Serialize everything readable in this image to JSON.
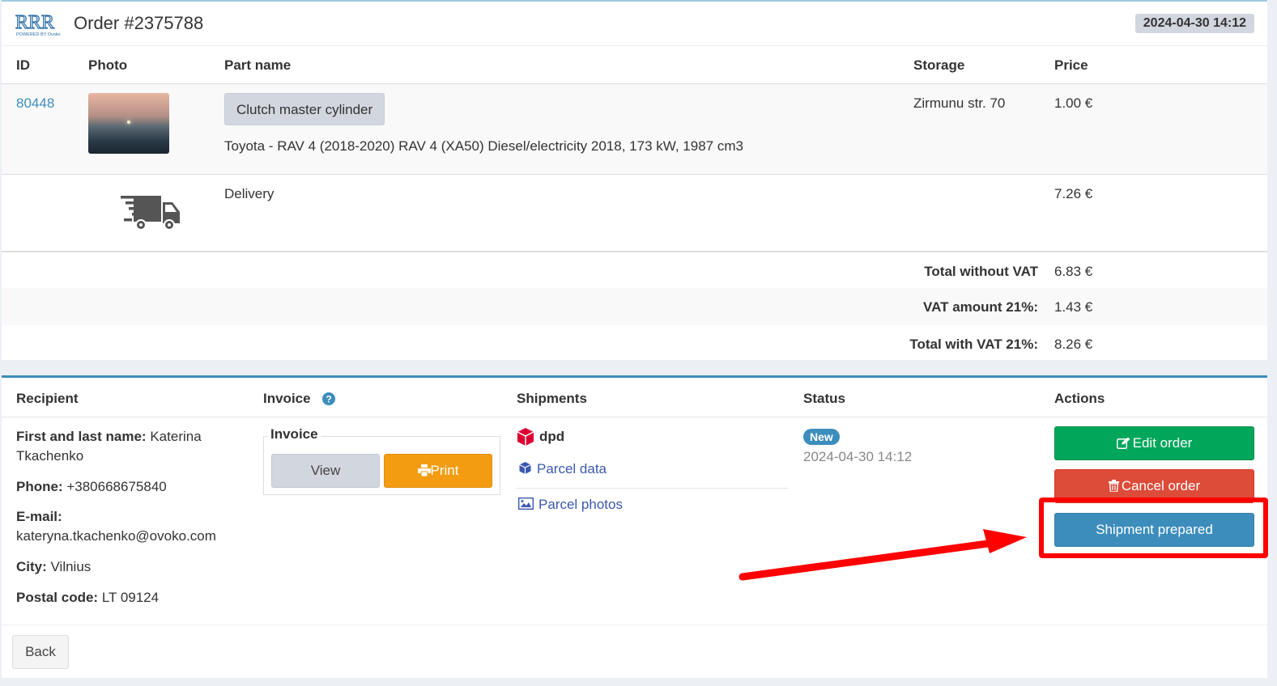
{
  "header": {
    "logo_text": "RRR",
    "logo_sub": "POWERED BY Ovoko",
    "title": "Order #2375788",
    "datetime": "2024-04-30 14:12"
  },
  "table": {
    "columns": [
      "ID",
      "Photo",
      "Part name",
      "Storage",
      "Price"
    ],
    "item": {
      "id": "80448",
      "part_name": "Clutch master cylinder",
      "vehicle": "Toyota - RAV 4 (2018-2020) RAV 4 (XA50) Diesel/electricity 2018, 173 kW, 1987 cm3",
      "storage": "Zirmunu str. 70",
      "price": "1.00 €"
    },
    "delivery": {
      "label": "Delivery",
      "price": "7.26 €",
      "icon": "truck-icon"
    }
  },
  "totals": [
    {
      "label": "Total without VAT",
      "value": "6.83 €"
    },
    {
      "label": "VAT amount 21%:",
      "value": "1.43 €"
    },
    {
      "label": "Total with VAT 21%:",
      "value": "8.26 €"
    }
  ],
  "details": {
    "headers": {
      "recipient": "Recipient",
      "invoice": "Invoice",
      "shipments": "Shipments",
      "status": "Status",
      "actions": "Actions"
    },
    "recipient": {
      "name_label": "First and last name:",
      "name_value": "Katerina",
      "name_value2": "Tkachenko",
      "phone_label": "Phone:",
      "phone_value": "+380668675840",
      "email_label": "E-mail:",
      "email_value": "kateryna.tkachenko@ovoko.com",
      "city_label": "City:",
      "city_value": "Vilnius",
      "postal_label": "Postal code:",
      "postal_value": "LT 09124"
    },
    "invoice": {
      "group_label": "Invoice",
      "view": "View",
      "print": "Print"
    },
    "shipments": {
      "carrier": "dpd",
      "parcel_data": "Parcel data",
      "parcel_photos": "Parcel photos"
    },
    "status": {
      "badge": "New",
      "datetime": "2024-04-30 14:12"
    },
    "actions": {
      "edit": "Edit order",
      "cancel": "Cancel order",
      "prepared": "Shipment prepared"
    }
  },
  "footer": {
    "back": "Back"
  },
  "colors": {
    "accent": "#3c8dbc",
    "success": "#00a65a",
    "danger": "#dd4b39",
    "warning": "#f39c12",
    "highlight": "#ff0000"
  }
}
